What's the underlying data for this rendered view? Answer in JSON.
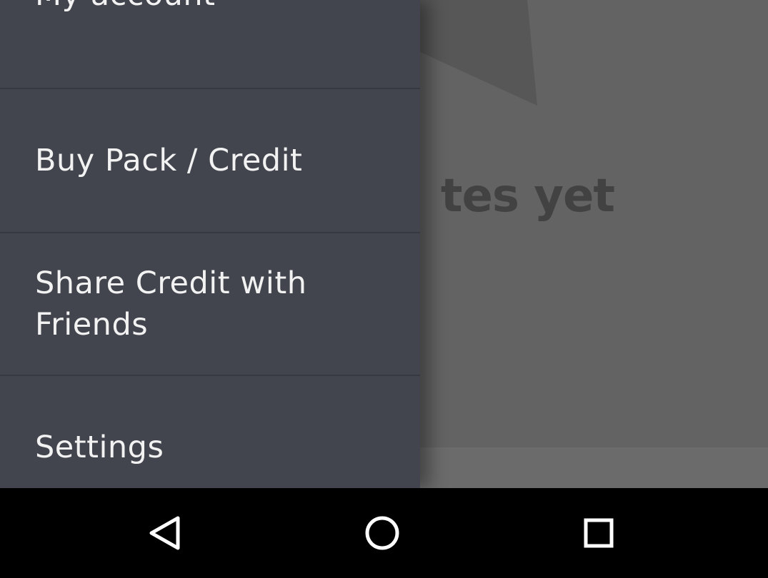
{
  "background": {
    "empty_message": "tes yet"
  },
  "drawer": {
    "items": [
      {
        "label": "My account"
      },
      {
        "label": "Buy Pack / Credit"
      },
      {
        "label": "Share Credit with Friends"
      },
      {
        "label": "Settings"
      }
    ]
  },
  "navbar": {
    "buttons": [
      {
        "icon": "back-icon"
      },
      {
        "icon": "home-icon"
      },
      {
        "icon": "recents-icon"
      }
    ]
  },
  "colors": {
    "drawer_bg": "#42454d",
    "drawer_text": "#f2f2f2",
    "scrim_bg": "#636363",
    "navbar_bg": "#000000"
  }
}
